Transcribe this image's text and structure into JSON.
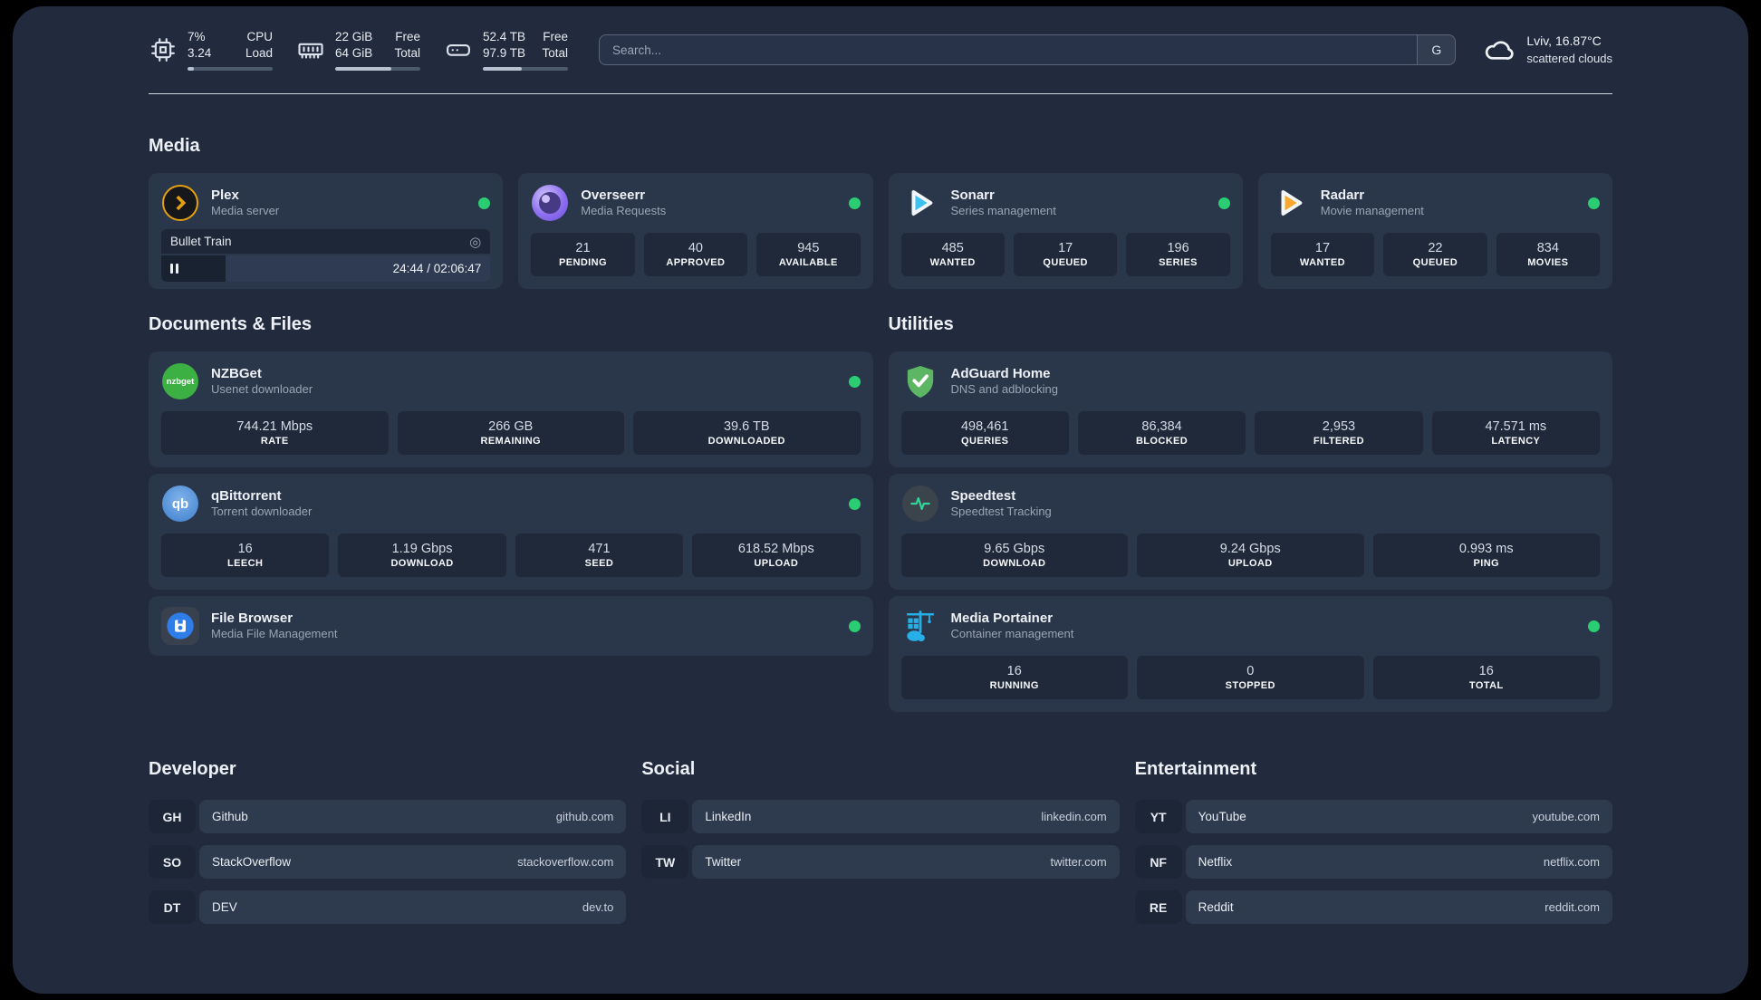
{
  "colors": {
    "background": "#000000",
    "panel": "#212b3d",
    "card": "#2a3649",
    "stat_box": "#1f2939",
    "status_online": "#2acd72",
    "plex_orange": "#e5a00d",
    "sonarr_blue": "#3ec0f0",
    "radarr_orange": "#f7a82d",
    "nzbget_green": "#3cb043",
    "qbittorrent_blue": "#3f7ecb",
    "adguard_green": "#5cb663",
    "speedtest_green": "#34d399",
    "portainer_blue": "#27b0e8",
    "filebrowser_blue": "#2e7de9"
  },
  "header": {
    "system_stats": [
      {
        "icon": "cpu-icon",
        "values": [
          "7%",
          "3.24"
        ],
        "labels": [
          "CPU",
          "Load"
        ],
        "progress": "7%"
      },
      {
        "icon": "memory-icon",
        "values": [
          "22 GiB",
          "64 GiB"
        ],
        "labels": [
          "Free",
          "Total"
        ],
        "progress": "66%"
      },
      {
        "icon": "disk-icon",
        "values": [
          "52.4 TB",
          "97.9 TB"
        ],
        "labels": [
          "Free",
          "Total"
        ],
        "progress": "46%"
      }
    ],
    "search": {
      "placeholder": "Search...",
      "provider_label": "G"
    },
    "weather": {
      "location": "Lviv, 16.87°C",
      "condition": "scattered clouds"
    }
  },
  "sections": {
    "media": {
      "title": "Media",
      "cards": [
        {
          "name": "Plex",
          "subtitle": "Media server",
          "status": "online",
          "player": {
            "title": "Bullet Train",
            "time": "24:44 / 02:06:47",
            "progress": "19.5%"
          }
        },
        {
          "name": "Overseerr",
          "subtitle": "Media Requests",
          "status": "online",
          "stats": [
            {
              "value": "21",
              "label": "PENDING"
            },
            {
              "value": "40",
              "label": "APPROVED"
            },
            {
              "value": "945",
              "label": "AVAILABLE"
            }
          ]
        },
        {
          "name": "Sonarr",
          "subtitle": "Series management",
          "status": "online",
          "stats": [
            {
              "value": "485",
              "label": "WANTED"
            },
            {
              "value": "17",
              "label": "QUEUED"
            },
            {
              "value": "196",
              "label": "SERIES"
            }
          ]
        },
        {
          "name": "Radarr",
          "subtitle": "Movie management",
          "status": "online",
          "stats": [
            {
              "value": "17",
              "label": "WANTED"
            },
            {
              "value": "22",
              "label": "QUEUED"
            },
            {
              "value": "834",
              "label": "MOVIES"
            }
          ]
        }
      ]
    },
    "documents": {
      "title": "Documents & Files",
      "cards": [
        {
          "name": "NZBGet",
          "subtitle": "Usenet downloader",
          "status": "online",
          "stats": [
            {
              "value": "744.21 Mbps",
              "label": "RATE"
            },
            {
              "value": "266 GB",
              "label": "REMAINING"
            },
            {
              "value": "39.6 TB",
              "label": "DOWNLOADED"
            }
          ]
        },
        {
          "name": "qBittorrent",
          "subtitle": "Torrent downloader",
          "status": "online",
          "stats": [
            {
              "value": "16",
              "label": "LEECH"
            },
            {
              "value": "1.19 Gbps",
              "label": "DOWNLOAD"
            },
            {
              "value": "471",
              "label": "SEED"
            },
            {
              "value": "618.52 Mbps",
              "label": "UPLOAD"
            }
          ]
        },
        {
          "name": "File Browser",
          "subtitle": "Media File Management",
          "status": "online"
        }
      ]
    },
    "utilities": {
      "title": "Utilities",
      "cards": [
        {
          "name": "AdGuard Home",
          "subtitle": "DNS and adblocking",
          "stats": [
            {
              "value": "498,461",
              "label": "QUERIES"
            },
            {
              "value": "86,384",
              "label": "BLOCKED"
            },
            {
              "value": "2,953",
              "label": "FILTERED"
            },
            {
              "value": "47.571 ms",
              "label": "LATENCY"
            }
          ]
        },
        {
          "name": "Speedtest",
          "subtitle": "Speedtest Tracking",
          "stats": [
            {
              "value": "9.65 Gbps",
              "label": "DOWNLOAD"
            },
            {
              "value": "9.24 Gbps",
              "label": "UPLOAD"
            },
            {
              "value": "0.993 ms",
              "label": "PING"
            }
          ]
        },
        {
          "name": "Media Portainer",
          "subtitle": "Container management",
          "status": "online",
          "stats": [
            {
              "value": "16",
              "label": "RUNNING"
            },
            {
              "value": "0",
              "label": "STOPPED"
            },
            {
              "value": "16",
              "label": "TOTAL"
            }
          ]
        }
      ]
    },
    "links": [
      {
        "title": "Developer",
        "items": [
          {
            "abbr": "GH",
            "name": "Github",
            "url": "github.com"
          },
          {
            "abbr": "SO",
            "name": "StackOverflow",
            "url": "stackoverflow.com"
          },
          {
            "abbr": "DT",
            "name": "DEV",
            "url": "dev.to"
          }
        ]
      },
      {
        "title": "Social",
        "items": [
          {
            "abbr": "LI",
            "name": "LinkedIn",
            "url": "linkedin.com"
          },
          {
            "abbr": "TW",
            "name": "Twitter",
            "url": "twitter.com"
          }
        ]
      },
      {
        "title": "Entertainment",
        "items": [
          {
            "abbr": "YT",
            "name": "YouTube",
            "url": "youtube.com"
          },
          {
            "abbr": "NF",
            "name": "Netflix",
            "url": "netflix.com"
          },
          {
            "abbr": "RE",
            "name": "Reddit",
            "url": "reddit.com"
          }
        ]
      }
    ]
  }
}
